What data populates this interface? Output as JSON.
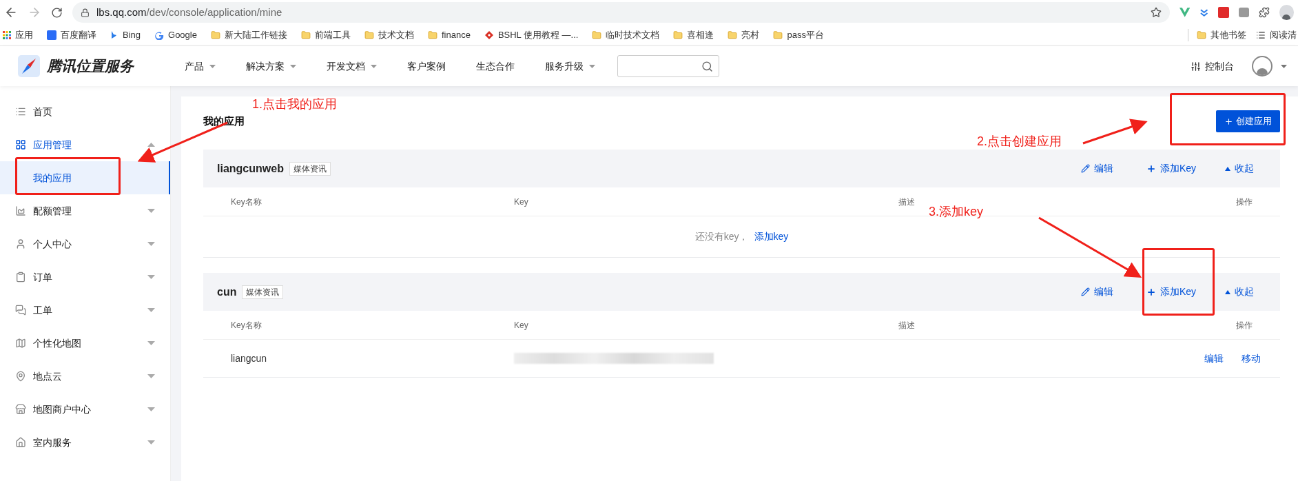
{
  "browser": {
    "url_host": "lbs.qq.com",
    "url_path": "/dev/console/application/mine",
    "bookmarks": [
      {
        "label": "应用",
        "kind": "apps"
      },
      {
        "label": "百度翻译",
        "kind": "site"
      },
      {
        "label": "Bing",
        "kind": "site"
      },
      {
        "label": "Google",
        "kind": "site"
      },
      {
        "label": "新大陆工作链接",
        "kind": "folder"
      },
      {
        "label": "前端工具",
        "kind": "folder"
      },
      {
        "label": "技术文档",
        "kind": "folder"
      },
      {
        "label": "finance",
        "kind": "folder"
      },
      {
        "label": "BSHL 使用教程 —...",
        "kind": "site"
      },
      {
        "label": "临时技术文档",
        "kind": "folder"
      },
      {
        "label": "喜相逢",
        "kind": "folder"
      },
      {
        "label": "亮村",
        "kind": "folder"
      },
      {
        "label": "pass平台",
        "kind": "folder"
      }
    ],
    "other_bookmarks": "其他书签",
    "reading_list": "阅读清"
  },
  "header": {
    "brand": "腾讯位置服务",
    "nav": [
      {
        "label": "产品",
        "dropdown": true
      },
      {
        "label": "解决方案",
        "dropdown": true
      },
      {
        "label": "开发文档",
        "dropdown": true
      },
      {
        "label": "客户案例",
        "dropdown": false
      },
      {
        "label": "生态合作",
        "dropdown": false
      },
      {
        "label": "服务升级",
        "dropdown": true
      }
    ],
    "console": "控制台"
  },
  "sidebar": {
    "items": [
      {
        "label": "首页",
        "expandable": false,
        "active": false
      },
      {
        "label": "应用管理",
        "expandable": true,
        "expanded": true,
        "active": true,
        "children": [
          {
            "label": "我的应用",
            "selected": true
          }
        ]
      },
      {
        "label": "配额管理",
        "expandable": true,
        "expanded": false,
        "active": false
      },
      {
        "label": "个人中心",
        "expandable": true,
        "expanded": false,
        "active": false
      },
      {
        "label": "订单",
        "expandable": true,
        "expanded": false,
        "active": false
      },
      {
        "label": "工单",
        "expandable": true,
        "expanded": false,
        "active": false
      },
      {
        "label": "个性化地图",
        "expandable": true,
        "expanded": false,
        "active": false
      },
      {
        "label": "地点云",
        "expandable": true,
        "expanded": false,
        "active": false
      },
      {
        "label": "地图商户中心",
        "expandable": true,
        "expanded": false,
        "active": false
      },
      {
        "label": "室内服务",
        "expandable": true,
        "expanded": false,
        "active": false
      }
    ]
  },
  "page": {
    "title": "我的应用",
    "create_button": "创建应用",
    "apps": [
      {
        "name": "liangcunweb",
        "tag": "媒体资讯",
        "actions": {
          "edit": "编辑",
          "add_key": "添加Key",
          "collapse": "收起"
        },
        "columns": [
          "Key名称",
          "Key",
          "描述",
          "操作"
        ],
        "empty": {
          "text": "还没有key，",
          "link": "添加key"
        }
      },
      {
        "name": "cun",
        "tag": "媒体资讯",
        "actions": {
          "edit": "编辑",
          "add_key": "添加Key",
          "collapse": "收起"
        },
        "columns": [
          "Key名称",
          "Key",
          "描述",
          "操作"
        ],
        "rows": [
          {
            "name": "liangcun",
            "key_redacted": true,
            "ops": [
              "编辑",
              "移动"
            ]
          }
        ]
      }
    ]
  },
  "annotations": [
    {
      "text": "1.点击我的应用"
    },
    {
      "text": "2.点击创建应用"
    },
    {
      "text": "3.添加key"
    }
  ]
}
